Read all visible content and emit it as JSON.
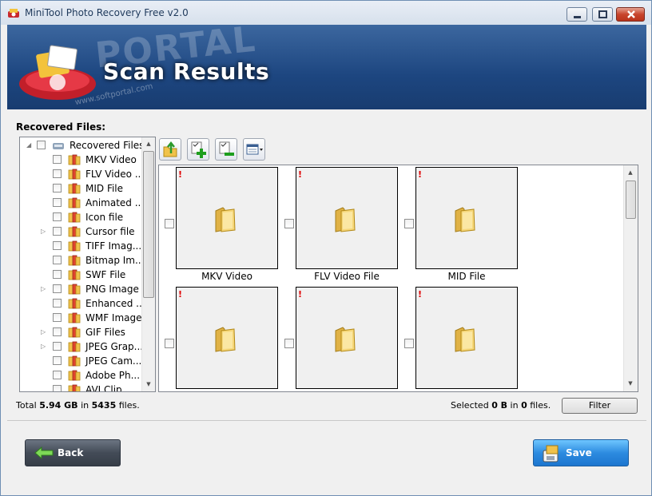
{
  "window": {
    "title": "MiniTool Photo Recovery Free v2.0"
  },
  "banner": {
    "title": "Scan Results",
    "watermark": "PORTAL",
    "watermark_url": "www.softportal.com"
  },
  "tree": {
    "label": "Recovered Files:",
    "root": "Recovered Files",
    "items": [
      {
        "label": "MKV Video",
        "expandable": false
      },
      {
        "label": "FLV Video ...",
        "expandable": false
      },
      {
        "label": "MID File",
        "expandable": false
      },
      {
        "label": "Animated ...",
        "expandable": false
      },
      {
        "label": "Icon file",
        "expandable": false
      },
      {
        "label": "Cursor file",
        "expandable": true
      },
      {
        "label": "TIFF Imag...",
        "expandable": false
      },
      {
        "label": "Bitmap Im...",
        "expandable": false
      },
      {
        "label": "SWF File",
        "expandable": false
      },
      {
        "label": "PNG Image",
        "expandable": true
      },
      {
        "label": "Enhanced ...",
        "expandable": false
      },
      {
        "label": "WMF Image",
        "expandable": false
      },
      {
        "label": "GIF Files",
        "expandable": true
      },
      {
        "label": "JPEG Grap...",
        "expandable": true
      },
      {
        "label": "JPEG Cam...",
        "expandable": false
      },
      {
        "label": "Adobe Ph...",
        "expandable": false
      },
      {
        "label": "AVI Clip",
        "expandable": false
      }
    ]
  },
  "toolbar": [
    "go-up-icon",
    "add-icon",
    "remove-icon",
    "view-icon"
  ],
  "thumbnails": [
    {
      "caption": "MKV Video",
      "warning": "!"
    },
    {
      "caption": "FLV Video File",
      "warning": "!"
    },
    {
      "caption": "MID File",
      "warning": "!"
    },
    {
      "caption": "",
      "warning": "!"
    },
    {
      "caption": "",
      "warning": "!"
    },
    {
      "caption": "",
      "warning": "!"
    }
  ],
  "status": {
    "total_prefix": "Total ",
    "total_size": "5.94 GB",
    "total_mid": " in ",
    "total_count": "5435",
    "total_suffix": " files.",
    "selected_prefix": "Selected ",
    "selected_size": "0 B",
    "selected_mid": " in ",
    "selected_count": "0",
    "selected_suffix": " files."
  },
  "buttons": {
    "filter": "Filter",
    "back": "Back",
    "save": "Save"
  },
  "colors": {
    "banner": "#1d4680",
    "back": "#434b57",
    "save": "#2d8be0",
    "warning": "#e00000"
  }
}
